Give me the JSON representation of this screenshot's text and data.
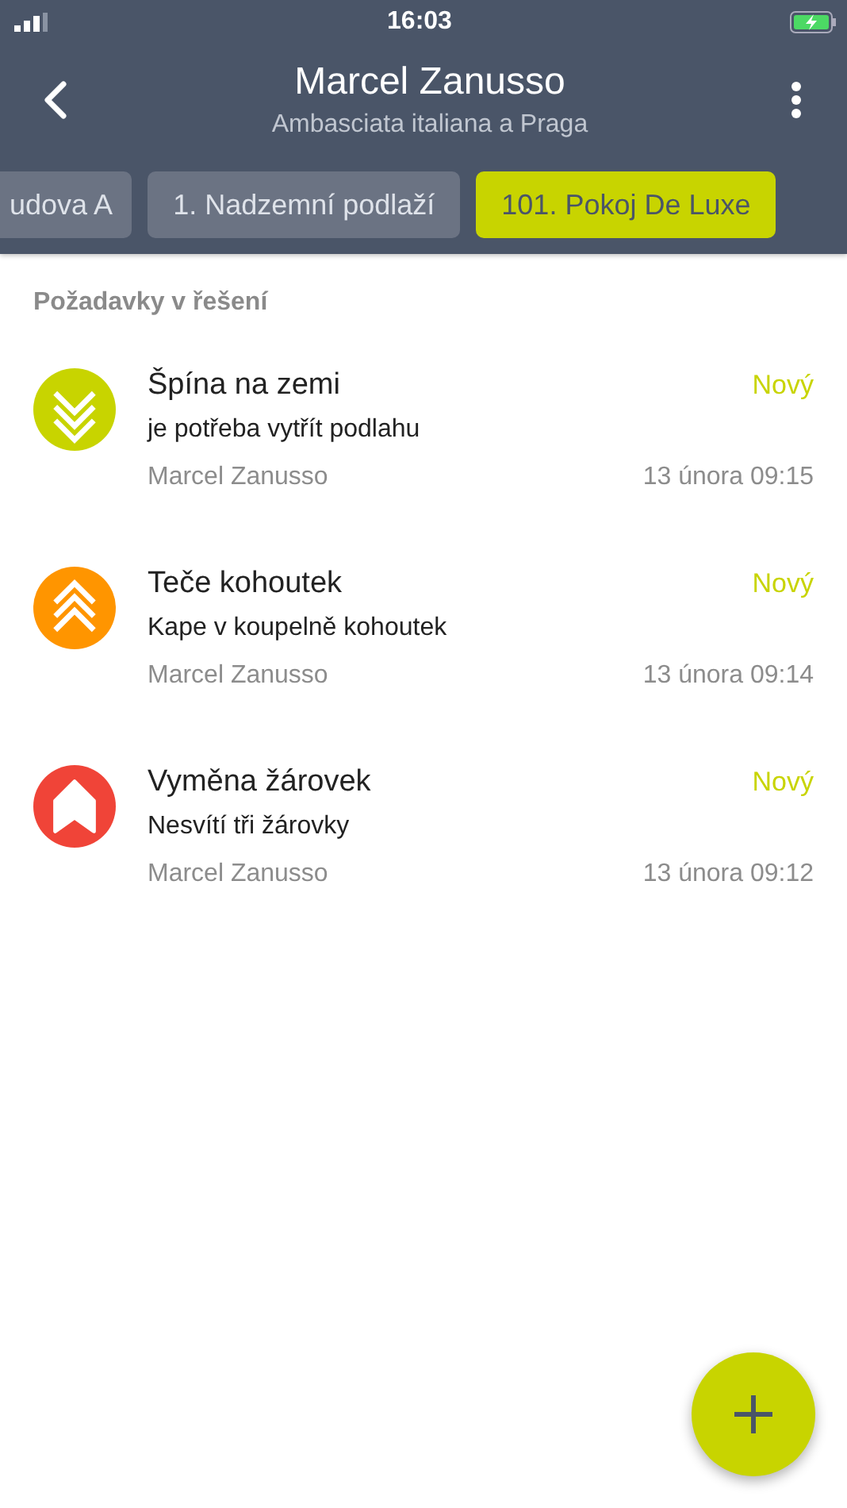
{
  "status_bar": {
    "time": "16:03"
  },
  "header": {
    "title": "Marcel Zanusso",
    "subtitle": "Ambasciata italiana a Praga"
  },
  "breadcrumbs": [
    {
      "label": "udova A",
      "selected": false
    },
    {
      "label": "1. Nadzemní podlaží",
      "selected": false
    },
    {
      "label": "101. Pokoj De Luxe",
      "selected": true
    }
  ],
  "section_title": "Požadavky v řešení",
  "requests": [
    {
      "title": "Špína na zemi",
      "description": "je potřeba vytřít podlahu",
      "status": "Nový",
      "author": "Marcel Zanusso",
      "time": "13 února 09:15",
      "kind": "low",
      "color": "#c8d400"
    },
    {
      "title": "Teče kohoutek",
      "description": "Kape v koupelně kohoutek",
      "status": "Nový",
      "author": "Marcel Zanusso",
      "time": "13 února 09:14",
      "kind": "high",
      "color": "#ff9500"
    },
    {
      "title": "Vyměna žárovek",
      "description": "Nesvítí tři žárovky",
      "status": "Nový",
      "author": "Marcel Zanusso",
      "time": "13 února 09:12",
      "kind": "critical",
      "color": "#f04438"
    }
  ]
}
